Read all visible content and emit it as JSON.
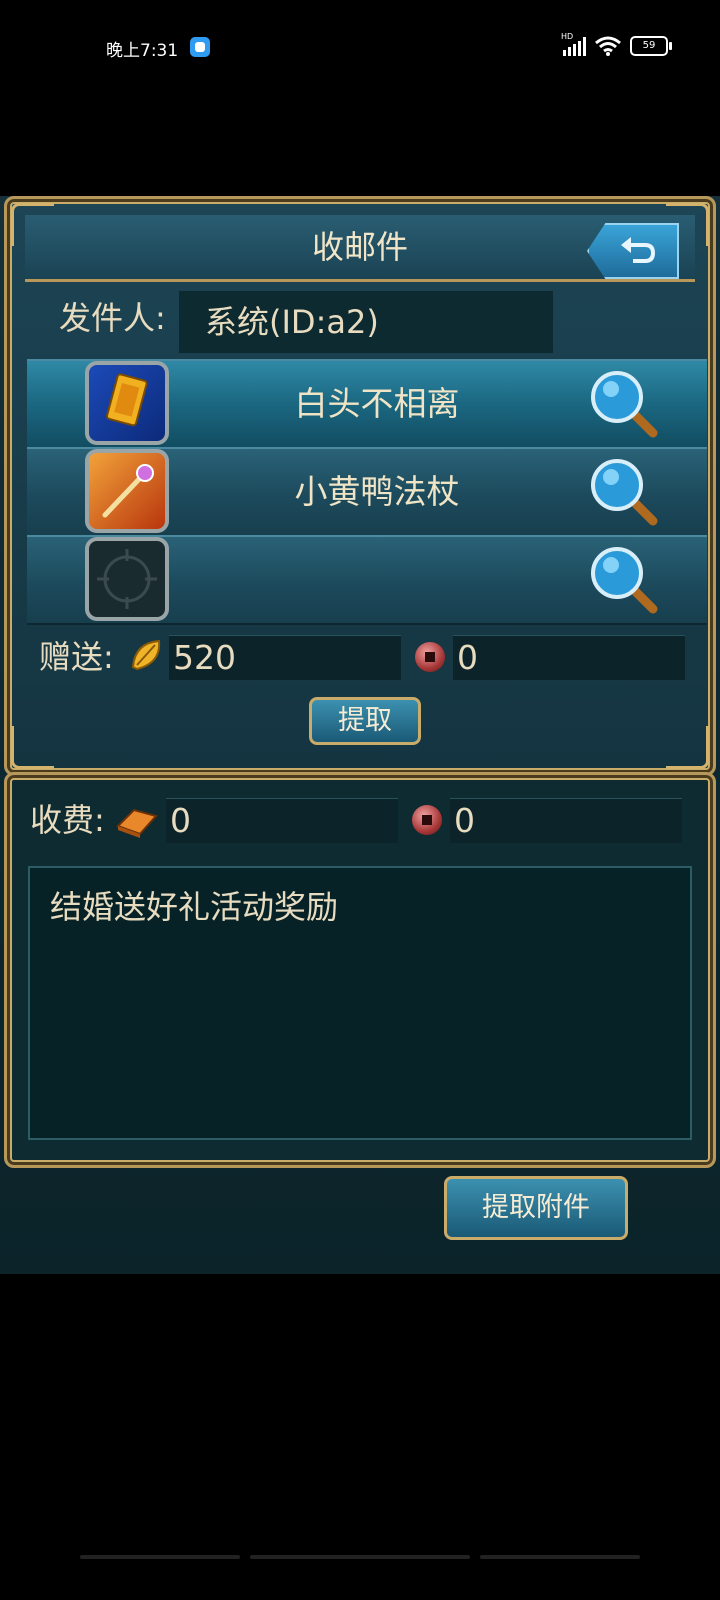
{
  "status": {
    "time": "晚上7:31",
    "battery": "59"
  },
  "window": {
    "title": "收邮件"
  },
  "sender": {
    "label": "发件人:",
    "value": "系统(ID:a2)"
  },
  "items": [
    {
      "name": "白头不相离",
      "icon": "love-card-icon",
      "selected": true
    },
    {
      "name": "小黄鸭法杖",
      "icon": "duck-staff-icon",
      "selected": false
    },
    {
      "name": "",
      "icon": "empty-slot-icon",
      "selected": false
    }
  ],
  "gift": {
    "label": "赠送:",
    "gold": "520",
    "coin": "0"
  },
  "extract_button": "提取",
  "fee": {
    "label": "收费:",
    "gold": "0",
    "coin": "0"
  },
  "message": "结婚送好礼活动奖励",
  "extract_all_button": "提取附件",
  "colors": {
    "accent_gold": "#c9ab6a",
    "panel": "#1d4555",
    "button": "#2a7a9a"
  }
}
